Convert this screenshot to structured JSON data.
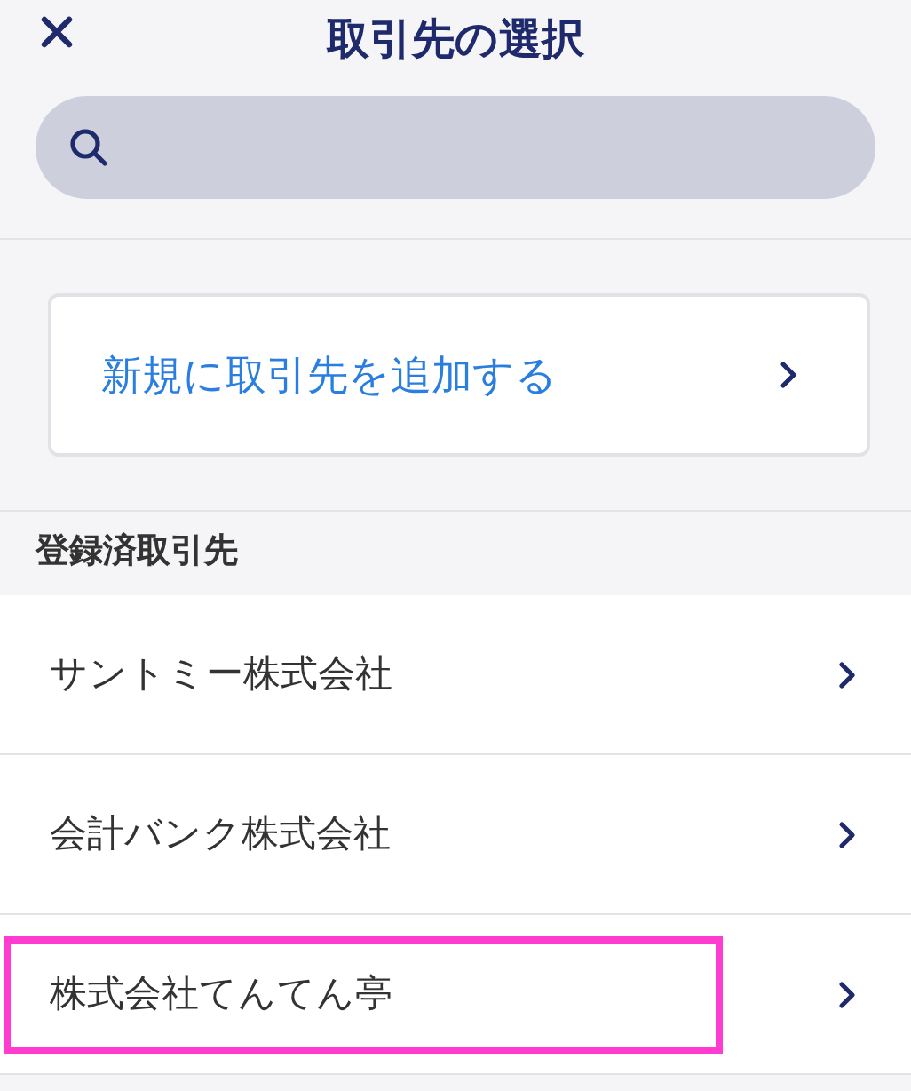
{
  "header": {
    "title": "取引先の選択"
  },
  "add_card": {
    "label": "新規に取引先を追加する"
  },
  "section": {
    "title": "登録済取引先"
  },
  "partners": [
    {
      "name": "サントミー株式会社",
      "highlighted": false
    },
    {
      "name": "会計バンク株式会社",
      "highlighted": false
    },
    {
      "name": "株式会社てんてん亭",
      "highlighted": true
    }
  ]
}
